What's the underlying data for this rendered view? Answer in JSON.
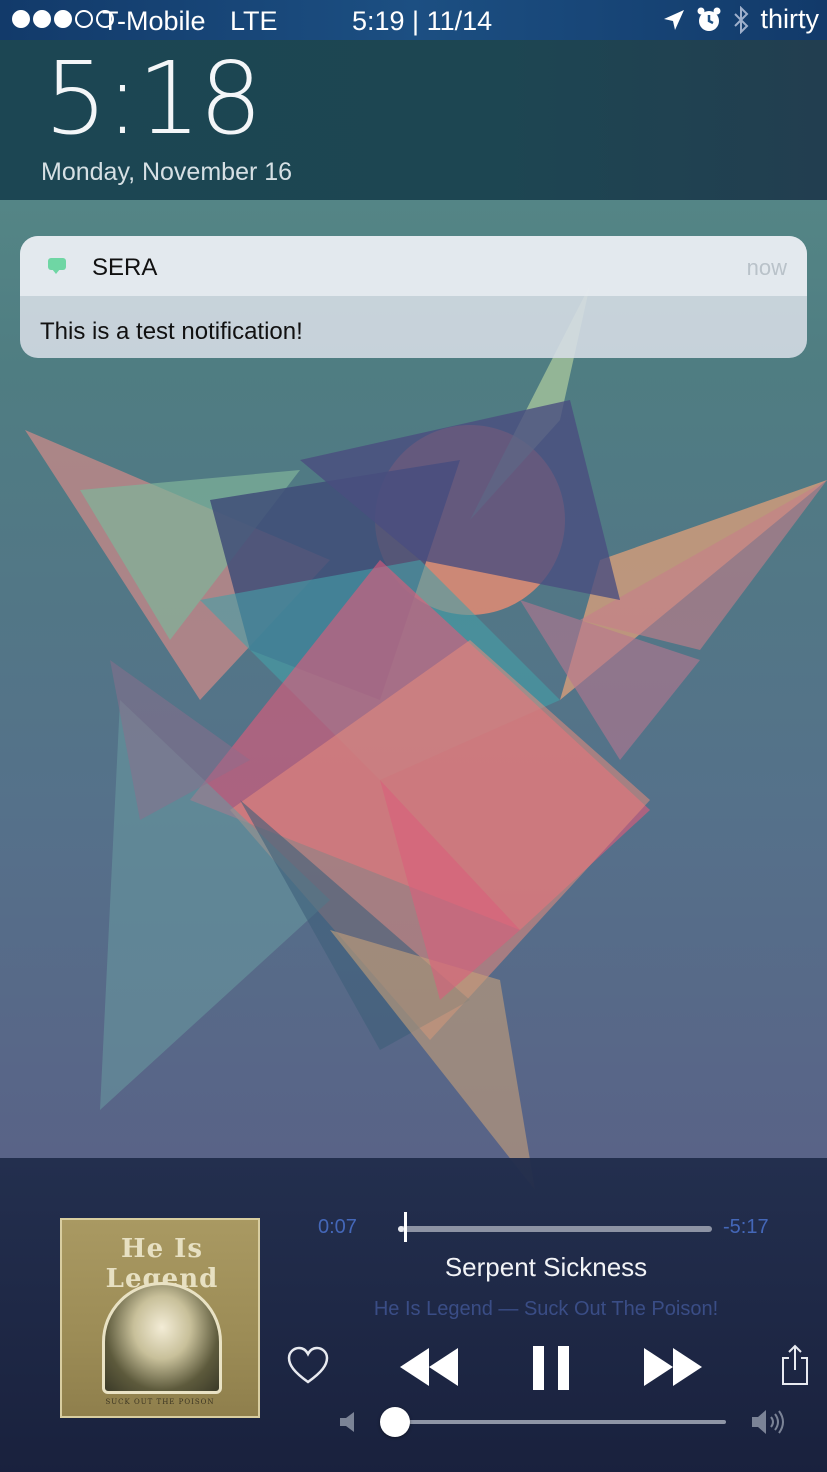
{
  "status_bar": {
    "carrier": "T-Mobile",
    "network": "LTE",
    "time_date": "5:19 | 11/14",
    "battery_text": "thirty",
    "signal_bars_filled": 3,
    "signal_bars_total": 5,
    "icons": [
      "location-arrow-icon",
      "alarm-icon",
      "bluetooth-icon"
    ]
  },
  "lockscreen": {
    "time": "5:18",
    "date": "Monday, November 16"
  },
  "notification": {
    "app_name": "SERA",
    "time": "now",
    "message": "This is a test notification!",
    "app_icon": "message-bubble-icon",
    "app_color": "#6fd6a4"
  },
  "now_playing": {
    "elapsed": "0:07",
    "remaining": "-5:17",
    "progress_fraction": 0.02,
    "title": "Serpent Sickness",
    "subtitle": "He Is Legend — Suck Out The Poison!",
    "album_art": {
      "band_logo": "He Is Legend",
      "caption": "SUCK OUT THE POISON"
    },
    "volume_fraction": 0.0,
    "controls": [
      "heart-icon",
      "rewind-icon",
      "pause-icon",
      "fast-forward-icon",
      "share-icon",
      "volume-low-icon",
      "volume-high-icon"
    ],
    "accent_color": "#4467b8"
  }
}
